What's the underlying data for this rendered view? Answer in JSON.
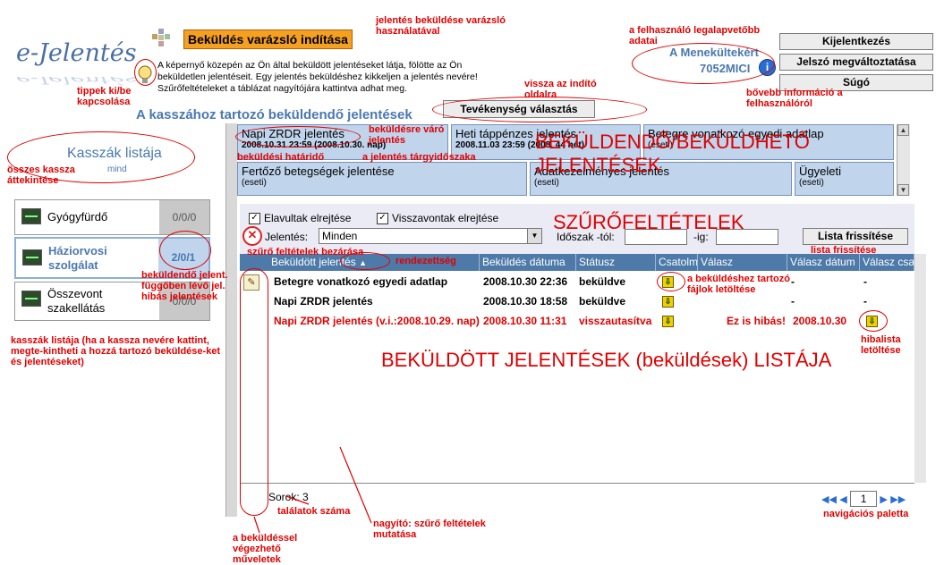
{
  "app": {
    "logo": "e-Jelentés"
  },
  "header": {
    "wizard_button": "Beküldés varázsló indítása",
    "hint_text": "A képernyő közepén az Ön által beküldött jelentéseket látja, fölötte az Ön beküldetlen jelentéseit. Egy jelentés beküldéshez kikkeljen a jelentés nevére! Szűrőfeltételeket a táblázat nagyítójára kattintva adhat meg.",
    "user_name": "A Menekültekért",
    "user_id": "7052MICI",
    "activity_button": "Tevékenység választás",
    "section_title": "A kasszához tartozó beküldendő jelentések"
  },
  "account_buttons": {
    "logout": "Kijelentkezés",
    "change_password": "Jelszó megváltoztatása",
    "help": "Súgó"
  },
  "sidebar": {
    "title": "Kasszák listája",
    "subtitle": "mind",
    "items": [
      {
        "name": "Gyógyfürdő",
        "count": "0/0/0"
      },
      {
        "name": "Háziorvosi szolgálat",
        "count": "2/0/1"
      },
      {
        "name": "Összevont szakellátás",
        "count": "0/0/0"
      }
    ]
  },
  "tabs": [
    {
      "title": "Napi ZRDR jelentés",
      "sub": "2008.10.31 23:59 (2008.10.30. nap)"
    },
    {
      "title": "Heti táppénzes jelentés",
      "sub": "2008.11.03 23:59 (2008. 44 hét)"
    },
    {
      "title": "Betegre vonatkozó egyedi adatlap",
      "sub": "(eseti)"
    },
    {
      "title": "Fertőző betegségek jelentése",
      "sub": "(eseti)"
    },
    {
      "title": "Adatkezelményes jelentés",
      "sub": "(eseti)"
    },
    {
      "title": "Ügyeleti",
      "sub": "(eseti)"
    }
  ],
  "filters": {
    "hide_expired": "Elavultak elrejtése",
    "hide_revoked": "Visszavontak elrejtése",
    "report_label": "Jelentés:",
    "report_value": "Minden",
    "period_from_label": "Időszak -tól:",
    "period_to_label": "-ig:",
    "refresh_button": "Lista frissítése"
  },
  "table": {
    "columns": [
      "Beküldött jelentés",
      "Beküldés dátuma",
      "Státusz",
      "Csatolmány",
      "Válasz",
      "Válasz dátum",
      "Válasz csa"
    ],
    "rows": [
      {
        "report": "Betegre vonatkozó egyedi adatlap",
        "date": "2008.10.30 22:36",
        "status": "beküldve",
        "reply": "-",
        "reply_date": "-",
        "reply_att": "-"
      },
      {
        "report": "Napi ZRDR jelentés",
        "date": "2008.10.30 18:58",
        "status": "beküldve",
        "reply": "-",
        "reply_date": "-",
        "reply_att": "-"
      },
      {
        "report": "Napi ZRDR jelentés (v.i.:2008.10.29. nap)",
        "date": "2008.10.30 11:31",
        "status": "visszautasítva",
        "reply": "Ez is hibás!",
        "reply_date": "2008.10.30",
        "reply_att": ""
      }
    ],
    "row_count": "Sorok: 3",
    "page": "1"
  },
  "annotations": {
    "a1": "jelentés beküldése varázsló használatával",
    "a2": "a felhasználó legalapvetőbb adatai",
    "a3": "tippek ki/be kapcsolása",
    "a4": "vissza az indító oldalra",
    "a5": "bővebb információ a felhasználóról",
    "a6": "beküldésre váró jelentés",
    "a7": "beküldési határidő",
    "a8": "a jelentés tárgyidőszaka",
    "a9": "összes kassza áttekintése",
    "a10": "BEKÜLDENDŐ/BEKÜLDHETŐ JELENTÉSEK",
    "a11": "SZŰRŐFELTÉTELEK",
    "a12": "szűrő feltételek bezárása",
    "a13": "rendezettség",
    "a14": "lista frissítése",
    "a15": "a beküldéshez tartozó fájlok letöltése",
    "a16": "beküldendő jelent. függőben lévő jel. hibás jelentések",
    "a17": "kasszák listája (ha a kassza nevére kattint, megte-kintheti a hozzá tartozó beküldése-ket és jelentéseket)",
    "a18": "hibalista letöltése",
    "a19": "BEKÜLDÖTT JELENTÉSEK (beküldések) LISTÁJA",
    "a20": "találatok száma",
    "a21": "nagyító: szűrő feltételek mutatása",
    "a22": "navigációs paletta",
    "a23": "a beküldéssel végezhető műveletek"
  }
}
